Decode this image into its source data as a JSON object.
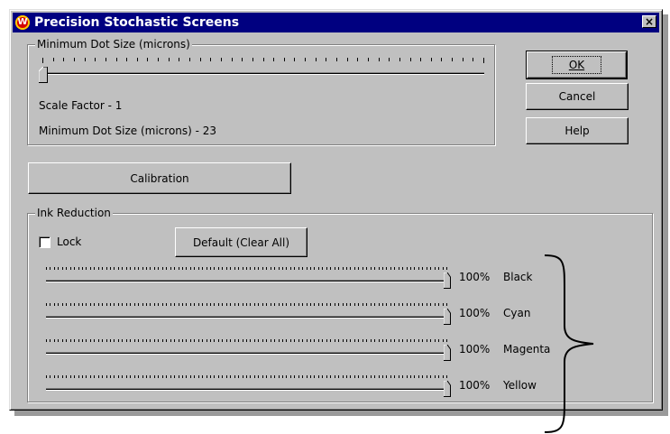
{
  "window": {
    "title": "Precision Stochastic Screens",
    "icon": "app-logo-icon",
    "close_glyph": "×"
  },
  "min_dot": {
    "group_label": "Minimum Dot Size (microns)",
    "slider_value": 0,
    "scale_factor_text": "Scale Factor - 1",
    "min_dot_text": "Minimum Dot Size (microns) - 23"
  },
  "buttons": {
    "ok": "OK",
    "cancel": "Cancel",
    "help": "Help",
    "calibration": "Calibration",
    "default": "Default (Clear All)"
  },
  "ink": {
    "group_label": "Ink Reduction",
    "lock_label": "Lock",
    "lock_checked": false,
    "channels": [
      {
        "name": "Black",
        "percent": "100%"
      },
      {
        "name": "Cyan",
        "percent": "100%"
      },
      {
        "name": "Magenta",
        "percent": "100%"
      },
      {
        "name": "Yellow",
        "percent": "100%"
      }
    ]
  }
}
